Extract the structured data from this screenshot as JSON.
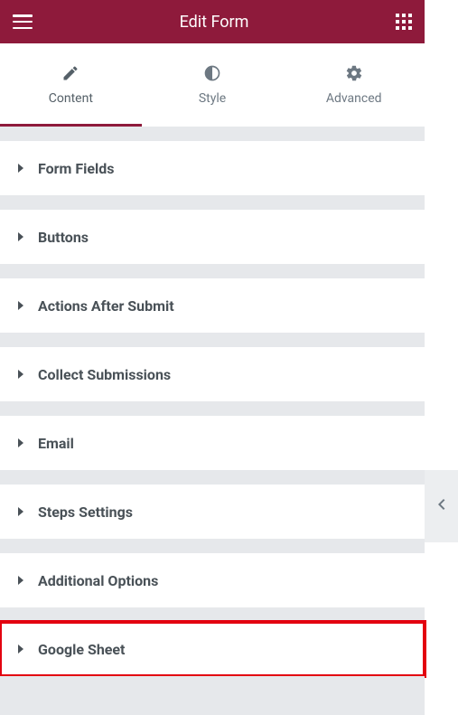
{
  "header": {
    "title": "Edit Form"
  },
  "tabs": [
    {
      "id": "content",
      "label": "Content",
      "active": true
    },
    {
      "id": "style",
      "label": "Style",
      "active": false
    },
    {
      "id": "advanced",
      "label": "Advanced",
      "active": false
    }
  ],
  "sections": [
    {
      "id": "form-fields",
      "label": "Form Fields",
      "highlighted": false
    },
    {
      "id": "buttons",
      "label": "Buttons",
      "highlighted": false
    },
    {
      "id": "actions-after-submit",
      "label": "Actions After Submit",
      "highlighted": false
    },
    {
      "id": "collect-submissions",
      "label": "Collect Submissions",
      "highlighted": false
    },
    {
      "id": "email",
      "label": "Email",
      "highlighted": false
    },
    {
      "id": "steps-settings",
      "label": "Steps Settings",
      "highlighted": false
    },
    {
      "id": "additional-options",
      "label": "Additional Options",
      "highlighted": false
    },
    {
      "id": "google-sheet",
      "label": "Google Sheet",
      "highlighted": true
    }
  ]
}
